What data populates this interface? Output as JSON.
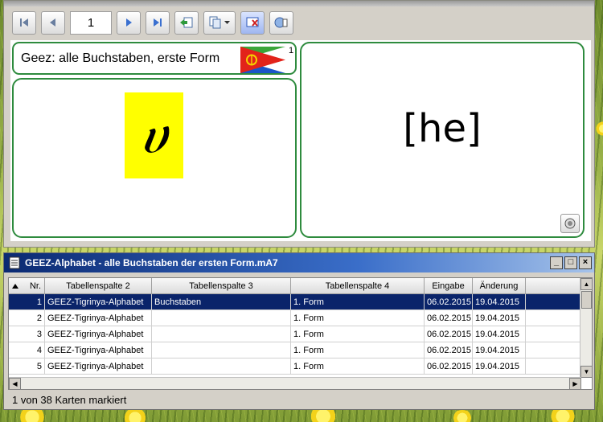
{
  "toolbar": {
    "page_number": "1"
  },
  "card": {
    "title": "Geez: alle Buchstaben, erste Form",
    "flag_count": "1",
    "front_glyph": "ሀ",
    "back_text": "[he]"
  },
  "list_window": {
    "title": "GEEZ-Alphabet - alle Buchstaben der ersten Form.mA7",
    "columns": [
      "Nr.",
      "Tabellenspalte 2",
      "Tabellenspalte 3",
      "Tabellenspalte 4",
      "Eingabe",
      "Änderung"
    ],
    "rows": [
      {
        "nr": "1",
        "col2": "GEEZ-Tigrinya-Alphabet",
        "col3": "Buchstaben",
        "col4": "1. Form",
        "eingabe": "06.02.2015",
        "aenderung": "19.04.2015"
      },
      {
        "nr": "2",
        "col2": "GEEZ-Tigrinya-Alphabet",
        "col3": "",
        "col4": "1. Form",
        "eingabe": "06.02.2015",
        "aenderung": "19.04.2015"
      },
      {
        "nr": "3",
        "col2": "GEEZ-Tigrinya-Alphabet",
        "col3": "",
        "col4": "1. Form",
        "eingabe": "06.02.2015",
        "aenderung": "19.04.2015"
      },
      {
        "nr": "4",
        "col2": "GEEZ-Tigrinya-Alphabet",
        "col3": "",
        "col4": "1. Form",
        "eingabe": "06.02.2015",
        "aenderung": "19.04.2015"
      },
      {
        "nr": "5",
        "col2": "GEEZ-Tigrinya-Alphabet",
        "col3": "",
        "col4": "1. Form",
        "eingabe": "06.02.2015",
        "aenderung": "19.04.2015"
      }
    ],
    "status": "1 von 38 Karten markiert"
  },
  "colors": {
    "card_border": "#2e8b3e",
    "selection": "#0a246a",
    "glyph_highlight": "#ffff00"
  }
}
